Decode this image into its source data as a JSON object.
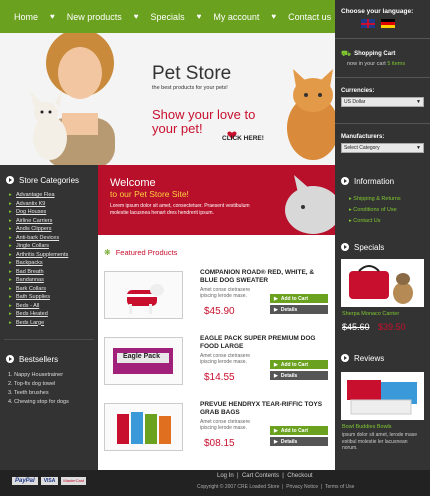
{
  "nav": {
    "items": [
      "Home",
      "New products",
      "Specials",
      "My account",
      "Contact us"
    ]
  },
  "language": {
    "label": "Choose your language:"
  },
  "cart": {
    "label": "Shopping Cart",
    "text_prefix": "now in your cart",
    "items": "5 items"
  },
  "currencies": {
    "label": "Currencies:",
    "selected": "US Dollar"
  },
  "manufacturers": {
    "label": "Manufacturers:",
    "selected": "Select Category"
  },
  "hero": {
    "brand": "Pet Store",
    "tagline": "the best products for your pets!",
    "slogan_line1": "Show your love to",
    "slogan_line2": "your pet!",
    "cta": "CLICK HERE!"
  },
  "welcome": {
    "title": "Welcome",
    "subtitle": "to our Pet Store Site!",
    "body": "Lorem ipsum dolor sit amet, consectetuer. Praesent vestibulum molestie lacusnea henart dres hendrerit ipsum."
  },
  "store_categories": {
    "title": "Store Categories",
    "items": [
      "Advantage Flea",
      "Advantix K9",
      "Dog Houses",
      "Airline Carriers",
      "Andis Clippers",
      "Anti-bark Devices",
      "Jingle Collars",
      "Arthritis Supplements",
      "Backpacks",
      "Bad Breath",
      "Bandannas",
      "Bark Collars",
      "Bath Supplies",
      "Beds - All",
      "Beds Heated",
      "Beds Large"
    ]
  },
  "bestsellers": {
    "title": "Bestsellers",
    "items": [
      "1. Nappy Housetrainer",
      "2. Top-fix dog towel",
      "3. Teeth brushes",
      "4. Chewing stop for dogs"
    ]
  },
  "featured": {
    "title": "Featured Products",
    "add_label": "Add to Cart",
    "details_label": "Details",
    "products": [
      {
        "title": "COMPANION ROAD® RED, WHITE, & BLUE DOG SWEATER",
        "desc": "Amet conse ctetrasere ipiscing lerode mase.",
        "price": "$45.90"
      },
      {
        "title": "EAGLE PACK SUPER PREMIUM DOG FOOD LARGE",
        "desc": "Amet conse ctetrasere ipiscing lerode mase.",
        "price": "$14.55",
        "package_text": "Eagle Pack"
      },
      {
        "title": "PREVUE HENDRYX TEAR-RIFFIC TOYS GRAB BAGS",
        "desc": "Amet conse ctetrasere ipiscing lerode mase.",
        "price": "$08.15"
      }
    ]
  },
  "information": {
    "title": "Information",
    "items": [
      "Shipping & Returns",
      "Conditions of Use",
      "Contact Us"
    ]
  },
  "specials": {
    "title": "Specials",
    "name": "Sherpa Monaco Carrier",
    "old_price": "$45.60",
    "new_price": "$39.50"
  },
  "reviews": {
    "title": "Reviews",
    "name": "Bowl Buddies Bowls",
    "text": "ipsum dolor sit amet, lerode mase estibul molestie ler lacusnean norum."
  },
  "footer": {
    "links": [
      "Log In",
      "Cart Contents",
      "Checkout"
    ],
    "copyright": "Copyright © 2007 CRE Loaded Store",
    "links2": [
      "Privacy Notice",
      "Terms of Use"
    ],
    "payment": [
      "PayPal",
      "VISA",
      "MasterCard"
    ]
  },
  "colors": {
    "green": "#6aa11e",
    "dark": "#333333",
    "red": "#c8102e"
  }
}
